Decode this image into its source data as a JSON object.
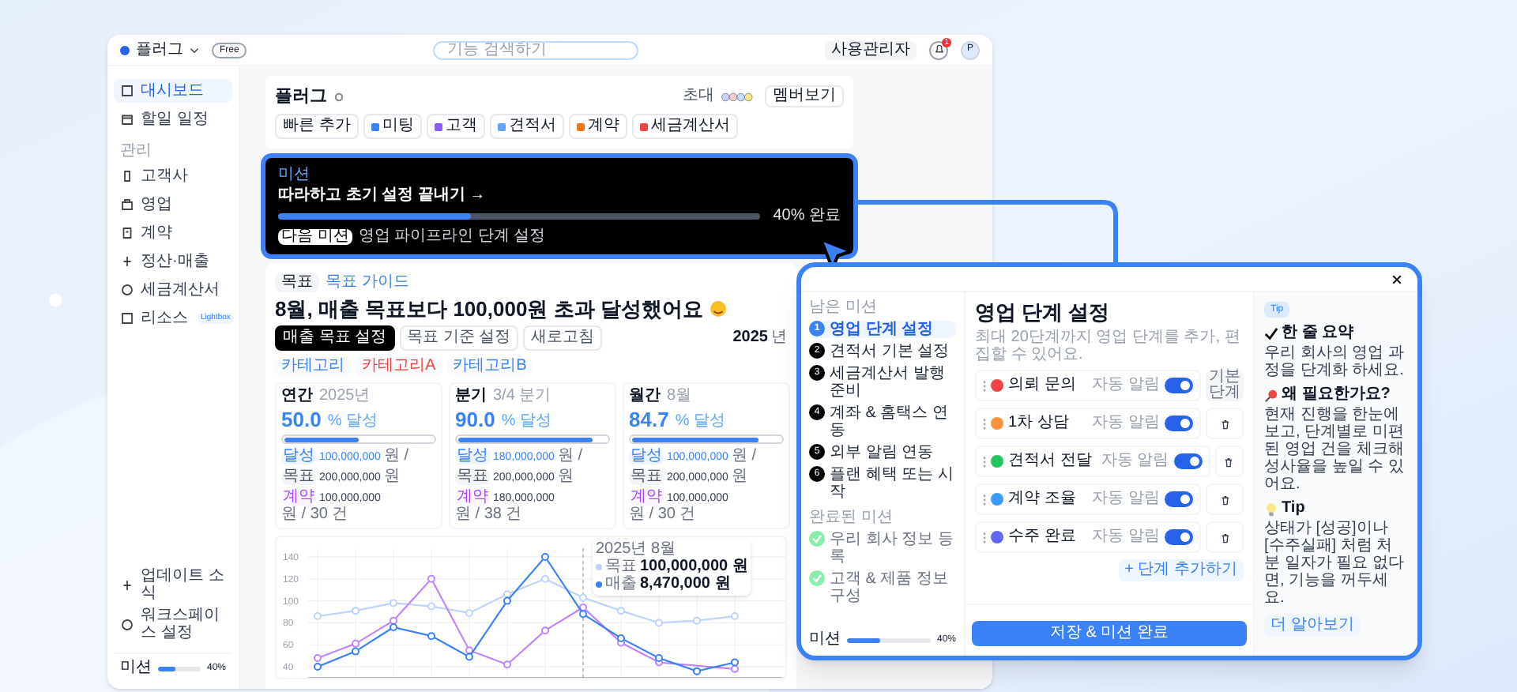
{
  "topbar": {
    "workspace": "플러그",
    "plan": "Free",
    "search": {
      "placeholder": "기능 검색하기"
    },
    "admin_button": "사용관리자",
    "notification_count": "1",
    "avatar": "P"
  },
  "sidebar": {
    "items": [
      {
        "label": "대시보드",
        "selected": true
      },
      {
        "label": "할일 일정",
        "selected": false
      }
    ],
    "section": "관리",
    "manage_items": [
      {
        "label": "고객사"
      },
      {
        "label": "영업"
      },
      {
        "label": "계약"
      },
      {
        "label": "정산·매출"
      },
      {
        "label": "세금계산서"
      },
      {
        "label": "리소스",
        "badge": "Lightbox"
      }
    ],
    "footer_items": [
      "업데이트 소식",
      "워크스페이스 설정"
    ],
    "mission": {
      "label": "미션",
      "level": 0.4,
      "reading": "40%"
    }
  },
  "workspace_card": {
    "title": "플러그",
    "quick_add": "빠른 추가",
    "chips": [
      {
        "label": "미팅",
        "color": "#3b82f6"
      },
      {
        "label": "고객",
        "color": "#8b5cf6"
      },
      {
        "label": "견적서",
        "color": "#60a5fa"
      },
      {
        "label": "계약",
        "color": "#f97316"
      },
      {
        "label": "세금계산서",
        "color": "#ef4444"
      }
    ],
    "invite_label": "초대",
    "member_button": "멤버보기"
  },
  "mission_banner": {
    "tag": "미션",
    "title": "따라하고 초기 설정 끝내기 →",
    "level": 0.4,
    "reading": "40% 완료",
    "next_badge": "다음 미션",
    "next_text": "영업 파이프라인 단계 설정"
  },
  "goal": {
    "tag": "목표",
    "guide_link": "목표 가이드",
    "headline": "8월, 매출 목표보다 **100,000원** 초과 달성했어요",
    "buttons": [
      {
        "label": "매출 목표 설정",
        "selected": true
      },
      {
        "label": "목표 기준 설정",
        "selected": false
      },
      {
        "label": "새로고침",
        "selected": false
      }
    ],
    "year": "2025",
    "year_unit": "년",
    "filters": [
      {
        "label": "카테고리",
        "color": "#3b82f6"
      },
      {
        "label": "카테고리A",
        "color": "#ef4444"
      },
      {
        "label": "카테고리B",
        "color": "#3b82f6"
      }
    ],
    "cards": [
      {
        "period": "연간",
        "sub": "2025년",
        "value": "50.0",
        "unit": "% 달성",
        "level": 0.5,
        "stats": [
          {
            "kind": "achieved",
            "tag": "달성",
            "amount": "100,000,000",
            "unit": "원 /"
          },
          {
            "kind": "target",
            "tag": "목표",
            "amount": "200,000,000",
            "unit": "원"
          },
          {
            "kind": "contract",
            "tag": "계약",
            "amount": "100,000,000",
            "unit": "원 / 30 건"
          }
        ]
      },
      {
        "period": "분기",
        "sub": "3/4 분기",
        "value": "90.0",
        "unit": "% 달성",
        "level": 0.9,
        "stats": [
          {
            "kind": "achieved",
            "tag": "달성",
            "amount": "180,000,000",
            "unit": "원 /"
          },
          {
            "kind": "target",
            "tag": "목표",
            "amount": "200,000,000",
            "unit": "원"
          },
          {
            "kind": "contract",
            "tag": "계약",
            "amount": "180,000,000",
            "unit": "원 / 38 건"
          }
        ]
      },
      {
        "period": "월간",
        "sub": "8월",
        "value": "84.7",
        "unit": "% 달성",
        "level": 0.85,
        "stats": [
          {
            "kind": "achieved",
            "tag": "달성",
            "amount": "100,000,000",
            "unit": "원 /"
          },
          {
            "kind": "target",
            "tag": "목표",
            "amount": "200,000,000",
            "unit": "원"
          },
          {
            "kind": "contract",
            "tag": "계약",
            "amount": "100,000,000",
            "unit": "원 / 30 건"
          }
        ]
      }
    ],
    "chart_data": {
      "type": "line",
      "ylim": [
        30,
        145
      ],
      "yticks": [
        40,
        60,
        80,
        100,
        120,
        140
      ],
      "grid": true,
      "series": [
        {
          "color": "#bfd4fb",
          "marker": true,
          "values": [
            86,
            91,
            98,
            95,
            89,
            106,
            120,
            103,
            91,
            80,
            82,
            86
          ]
        },
        {
          "color": "#c084fc",
          "marker": true,
          "values": [
            48,
            61,
            82,
            120,
            55,
            42,
            73,
            94,
            62,
            44,
            null,
            38
          ]
        },
        {
          "color": "#3b82f6",
          "marker": true,
          "values": [
            40,
            54,
            76,
            68,
            49,
            100,
            140,
            88,
            66,
            48,
            36,
            44
          ]
        }
      ]
    },
    "tooltip": {
      "title": "2025년 8월",
      "rows": [
        {
          "label": "목표",
          "value": "100,000,000 원",
          "color": "#bfd4fb"
        },
        {
          "label": "매출",
          "value": "8,470,000 원",
          "color": "#3b82f6"
        }
      ]
    }
  },
  "modal": {
    "remaining_label": "남은 미션",
    "steps": [
      {
        "number": "1",
        "label": "영업 단계 설정",
        "selected": true
      },
      {
        "number": "2",
        "label": "견적서 기본 설정",
        "selected": false
      },
      {
        "number": "3",
        "label": "세금계산서 발행 준비",
        "selected": false
      },
      {
        "number": "4",
        "label": "계좌 & 홈택스 연동",
        "selected": false
      },
      {
        "number": "5",
        "label": "외부 알림 연동",
        "selected": false
      },
      {
        "number": "6",
        "label": "플랜 혜택 또는 시작",
        "selected": false
      }
    ],
    "done_label": "완료된 미션",
    "done": [
      "우리 회사 정보 등록",
      "고객 & 제품 정보 구성"
    ],
    "mission": {
      "label": "미션",
      "level": 0.4,
      "reading": "40%"
    },
    "title": "영업 단계 설정",
    "subtitle": "최대 20단계까지 영업 단계를 추가, 편집할 수 있어요.",
    "stages": [
      {
        "kind": "default",
        "name": "의뢰 문의",
        "color": "#ef4444",
        "auto_label": "자동 알림",
        "on": true,
        "default_label": "기본단계"
      },
      {
        "kind": "deletable",
        "name": "1차 상담",
        "color": "#fb923c",
        "auto_label": "자동 알림",
        "on": true
      },
      {
        "kind": "deletable",
        "name": "견적서 전달",
        "color": "#22c55e",
        "auto_label": "자동 알림",
        "on": true
      },
      {
        "kind": "deletable",
        "name": "계약 조율",
        "color": "#3b9cf6",
        "auto_label": "자동 알림",
        "on": true
      },
      {
        "kind": "deletable",
        "name": "수주 완료",
        "color": "#6366f1",
        "auto_label": "자동 알림",
        "on": true
      }
    ],
    "add_button": "+ 단계 추가하기",
    "save_button": "저장 & 미션 완료",
    "tip": {
      "badge": "Tip",
      "sections": [
        {
          "kind": "summary",
          "heading": "한 줄 요약",
          "body": "우리 회사의 영업 과정을 단계화 하세요."
        },
        {
          "kind": "why",
          "heading": "왜 필요한가요?",
          "body": "현재 진행을 한눈에보고, 단계별로 미편된 영업 건을 체크해 성사율을 높일 수 있어요."
        },
        {
          "kind": "tip",
          "heading": "Tip",
          "body": "상태가 [성공]이나 [수주실패] 처럼 처분 일자가 필요 없다면, 기능을 꺼두세요."
        }
      ],
      "link": "더 알아보기"
    }
  }
}
